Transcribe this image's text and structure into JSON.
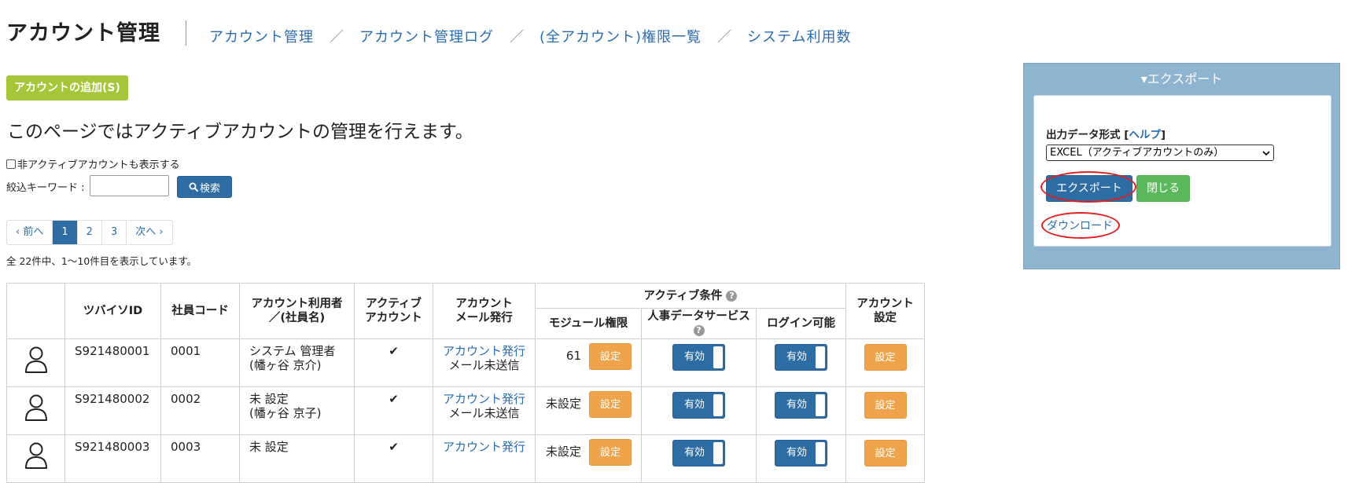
{
  "header": {
    "title": "アカウント管理",
    "breadcrumb": [
      "アカウント管理",
      "アカウント管理ログ",
      "(全アカウント)権限一覧",
      "システム利用数"
    ],
    "separator": "／"
  },
  "actions": {
    "add_account": "アカウントの追加(S)"
  },
  "intro_text": "このページではアクティブアカウントの管理を行えます。",
  "filters": {
    "show_inactive_label": "非アクティブアカウントも表示する",
    "keyword_label": "絞込キーワード :",
    "keyword_value": "",
    "search_button": "検索"
  },
  "pagination": {
    "prev": "‹ 前へ",
    "pages": [
      "1",
      "2",
      "3"
    ],
    "current": "1",
    "next": "次へ ›"
  },
  "results_text": "全 22件中、1〜10件目を表示しています。",
  "table": {
    "headers": {
      "tsubaiso_id": "ツバイソID",
      "employee_code": "社員コード",
      "user_line1": "アカウント利用者",
      "user_line2": "／(社員名)",
      "active_line1": "アクティブ",
      "active_line2": "アカウント",
      "mail_line1": "アカウント",
      "mail_line2": "メール発行",
      "active_conditions": "アクティブ条件",
      "module_permissions": "モジュール権限",
      "hr_data_service": "人事データサービス",
      "login_allowed": "ログイン可能",
      "settings_line1": "アカウント",
      "settings_line2": "設定"
    },
    "rows": [
      {
        "id": "S921480001",
        "code": "0001",
        "user": "システム 管理者",
        "employee": "(幡ヶ谷 京介)",
        "active": "✔",
        "issue_link": "アカウント発行",
        "mail_status": "メール未送信",
        "module_count": "61",
        "set_label": "設定",
        "hr_state": "有効",
        "login_state": "有効",
        "account_set": "設定"
      },
      {
        "id": "S921480002",
        "code": "0002",
        "user": "未 設定",
        "employee": "(幡ヶ谷 京子)",
        "active": "✔",
        "issue_link": "アカウント発行",
        "mail_status": "メール未送信",
        "module_count": "未設定",
        "set_label": "設定",
        "hr_state": "有効",
        "login_state": "有効",
        "account_set": "設定"
      },
      {
        "id": "S921480003",
        "code": "0003",
        "user": "未 設定",
        "employee": "",
        "active": "✔",
        "issue_link": "アカウント発行",
        "mail_status": "",
        "module_count": "未設定",
        "set_label": "設定",
        "hr_state": "有効",
        "login_state": "有効",
        "account_set": "設定"
      }
    ]
  },
  "export_panel": {
    "title": "▾エクスポート",
    "format_label_prefix": "出力データ形式 [",
    "format_help": "ヘルプ",
    "format_label_suffix": "]",
    "format_selected": "EXCEL（アクティブアカウントのみ）",
    "export_button": "エクスポート",
    "close_button": "閉じる",
    "download_link": "ダウンロード"
  },
  "colors": {
    "primary": "#2e6da4",
    "add_button": "#a5c638",
    "settings_button": "#efa44c",
    "close_button": "#5cb85c",
    "panel_bg": "#8fb4d0",
    "annotation_ring": "#e02020"
  },
  "icons": {
    "search": "magnifier-icon",
    "help": "question-circle-icon",
    "avatar": "user-outline-icon",
    "check": "checkmark-icon",
    "dropdown": "chevron-down-icon"
  }
}
